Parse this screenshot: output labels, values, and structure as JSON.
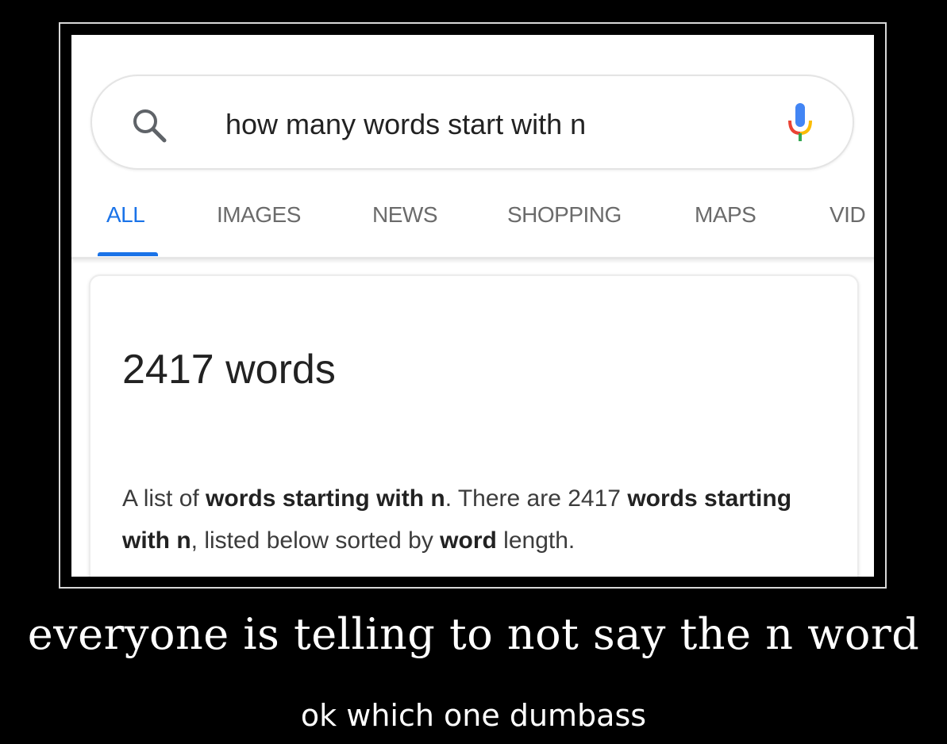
{
  "search": {
    "query": "how many words start with n"
  },
  "tabs": [
    {
      "label": "ALL",
      "active": true
    },
    {
      "label": "IMAGES"
    },
    {
      "label": "NEWS"
    },
    {
      "label": "SHOPPING"
    },
    {
      "label": "MAPS"
    },
    {
      "label": "VID"
    }
  ],
  "result": {
    "answer": "2417 words",
    "snippet_parts": [
      {
        "text": "A list of ",
        "bold": false
      },
      {
        "text": "words starting with n",
        "bold": true
      },
      {
        "text": ". There are 2417 ",
        "bold": false
      },
      {
        "text": "words starting with n",
        "bold": true
      },
      {
        "text": ", listed below sorted by ",
        "bold": false
      },
      {
        "text": "word",
        "bold": true
      },
      {
        "text": " length.",
        "bold": false
      }
    ]
  },
  "meme": {
    "caption": "everyone is telling to not say the n word",
    "subcaption": "ok which one dumbass"
  },
  "colors": {
    "accent": "#1a73e8",
    "mic_blue": "#4285f4",
    "mic_red": "#ea4335",
    "mic_yellow": "#fbbc05",
    "mic_green": "#34a853"
  },
  "icons": {
    "search": "search-icon",
    "mic": "mic-icon"
  }
}
